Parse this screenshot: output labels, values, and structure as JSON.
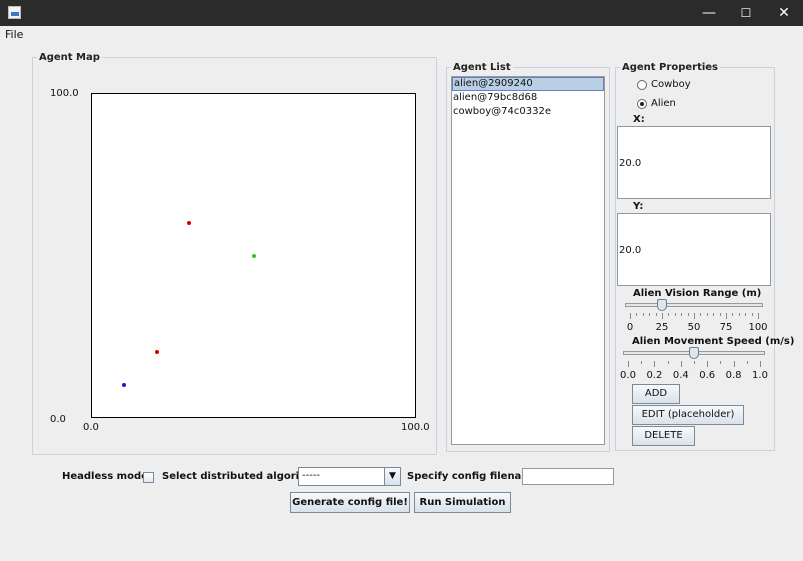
{
  "window": {
    "minimize_glyph": "—",
    "maximize_glyph": "☐",
    "close_glyph": "✕"
  },
  "menu": {
    "file": "File"
  },
  "agent_map": {
    "legend": "Agent Map",
    "y_max": "100.0",
    "y_min": "0.0",
    "x_min": "0.0",
    "x_max": "100.0",
    "points": [
      {
        "x": 30,
        "y": 60,
        "color": "#d40000"
      },
      {
        "x": 50,
        "y": 50,
        "color": "#22cc22"
      },
      {
        "x": 20,
        "y": 20,
        "color": "#d40000"
      },
      {
        "x": 10,
        "y": 10,
        "color": "#1a1acc"
      }
    ]
  },
  "agent_list": {
    "legend": "Agent List",
    "items": [
      "alien@2909240",
      "alien@79bc8d68",
      "cowboy@74c0332e"
    ],
    "selected_index": 0
  },
  "properties": {
    "legend": "Agent Properties",
    "radio_cowboy": "Cowboy",
    "radio_alien": "Alien",
    "selected": "Alien",
    "x_label": "X:",
    "x_value": "20.0",
    "y_label": "Y:",
    "y_value": "20.0",
    "vision_label": "Alien Vision Range (m)",
    "vision_value": 25,
    "vision_ticks": [
      "0",
      "25",
      "50",
      "75",
      "100"
    ],
    "speed_label": "Alien Movement Speed (m/s)",
    "speed_value": 0.5,
    "speed_ticks": [
      "0.0",
      "0.2",
      "0.4",
      "0.6",
      "0.8",
      "1.0"
    ],
    "add_button": "ADD",
    "edit_button": "EDIT (placeholder)",
    "delete_button": "DELETE"
  },
  "bottom": {
    "headless_label": "Headless mode:",
    "algorithm_label": "Select distributed algorithm:",
    "algorithm_value": "-----",
    "config_label": "Specify config filename:",
    "config_value": "",
    "generate_button": "Generate config file!",
    "run_button": "Run Simulation"
  }
}
